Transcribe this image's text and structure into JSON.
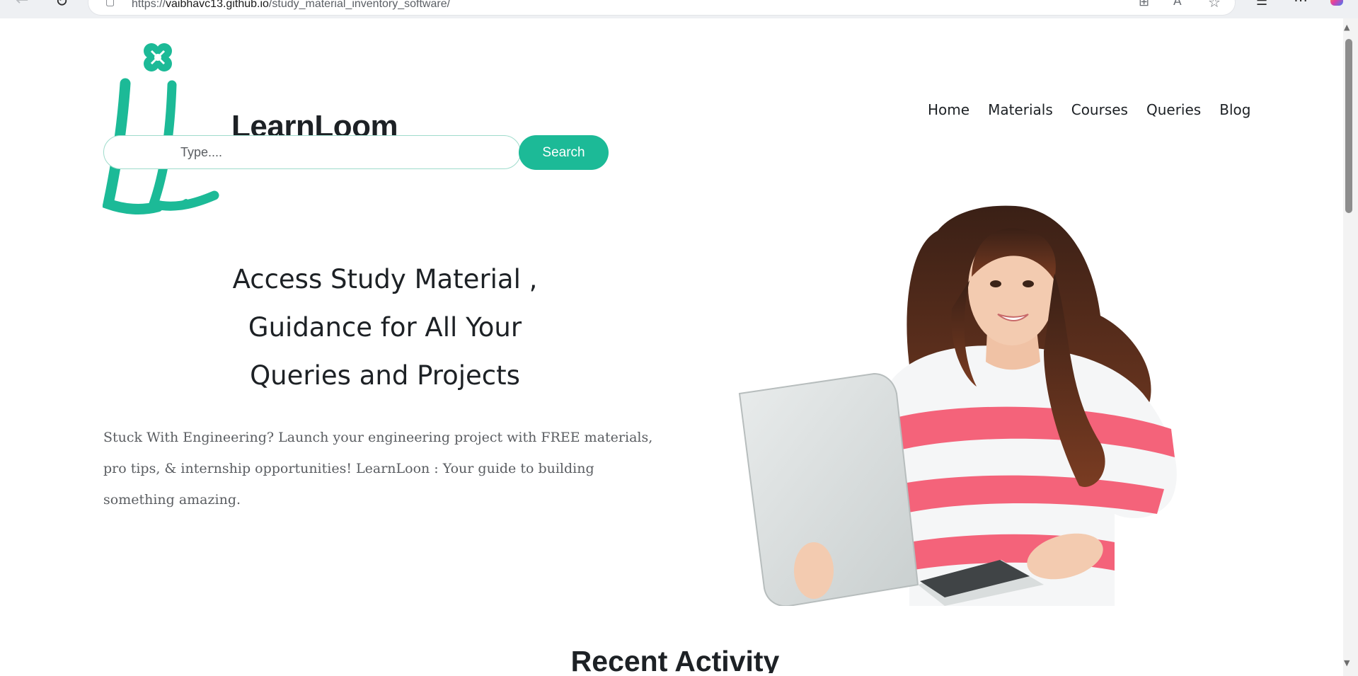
{
  "browser": {
    "url_prefix": "https://",
    "url_host": "vaibhavc13.github.io",
    "url_path": "/study_material_inventory_software/",
    "icons": [
      "back-icon",
      "refresh-icon",
      "site-info-icon",
      "split-screen-icon",
      "read-aloud-icon",
      "favorite-star-icon",
      "favorites-list-icon",
      "more-icon",
      "copilot-icon"
    ]
  },
  "header": {
    "brand": "LearnLoom",
    "search_placeholder": "Type....",
    "search_button": "Search",
    "nav": [
      "Home",
      "Materials",
      "Courses",
      "Queries",
      "Blog"
    ]
  },
  "hero": {
    "title_lines": [
      "Access Study Material ,",
      "Guidance for All Your",
      "Queries and Projects"
    ],
    "description": "Stuck With Engineering? Launch your engineering project with FREE materials, pro tips, & internship opportunities! LearnLoon : Your guide to building something amazing."
  },
  "recent": {
    "title": "Recent Activity"
  },
  "colors": {
    "accent": "#1cba97",
    "text": "#1d2125",
    "muted": "#5a5d61"
  }
}
